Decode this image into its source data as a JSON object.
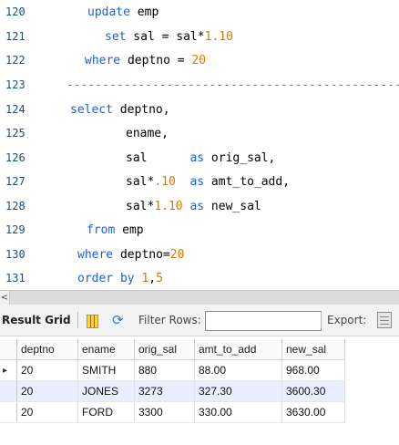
{
  "editor": {
    "lines": [
      {
        "n": "120",
        "parts": [
          {
            "t": "update",
            "c": "kw"
          },
          {
            "t": " emp",
            "c": "plain"
          }
        ]
      },
      {
        "n": "121",
        "parts": [
          {
            "t": "set",
            "c": "kw"
          },
          {
            "t": " sal = sal*",
            "c": "plain"
          },
          {
            "t": "1.10",
            "c": "num"
          }
        ]
      },
      {
        "n": "122",
        "parts": [
          {
            "t": "where",
            "c": "kw"
          },
          {
            "t": " deptno = ",
            "c": "plain"
          },
          {
            "t": "20",
            "c": "num"
          }
        ]
      },
      {
        "n": "123",
        "parts": [
          {
            "t": "------------------------------------------------",
            "c": "dash"
          }
        ]
      },
      {
        "n": "124",
        "parts": [
          {
            "t": "select",
            "c": "kw"
          },
          {
            "t": " deptno,",
            "c": "plain"
          }
        ]
      },
      {
        "n": "125",
        "parts": [
          {
            "t": "ename,",
            "c": "plain"
          }
        ]
      },
      {
        "n": "126",
        "parts": [
          {
            "t": "sal      ",
            "c": "plain"
          },
          {
            "t": "as",
            "c": "kw"
          },
          {
            "t": " orig_sal,",
            "c": "plain"
          }
        ]
      },
      {
        "n": "127",
        "parts": [
          {
            "t": "sal*",
            "c": "plain"
          },
          {
            "t": ".10",
            "c": "num"
          },
          {
            "t": "  ",
            "c": "plain"
          },
          {
            "t": "as",
            "c": "kw"
          },
          {
            "t": " amt_to_add,",
            "c": "plain"
          }
        ]
      },
      {
        "n": "128",
        "parts": [
          {
            "t": "sal*",
            "c": "plain"
          },
          {
            "t": "1.10",
            "c": "num"
          },
          {
            "t": " ",
            "c": "plain"
          },
          {
            "t": "as",
            "c": "kw"
          },
          {
            "t": " new_sal",
            "c": "plain"
          }
        ]
      },
      {
        "n": "129",
        "parts": [
          {
            "t": "from",
            "c": "kw"
          },
          {
            "t": " emp",
            "c": "plain"
          }
        ]
      },
      {
        "n": "130",
        "parts": [
          {
            "t": "where",
            "c": "kw"
          },
          {
            "t": " deptno=",
            "c": "plain"
          },
          {
            "t": "20",
            "c": "num"
          }
        ]
      },
      {
        "n": "131",
        "parts": [
          {
            "t": "order by",
            "c": "kw"
          },
          {
            "t": " ",
            "c": "plain"
          },
          {
            "t": "1",
            "c": "num"
          },
          {
            "t": ",",
            "c": "plain"
          },
          {
            "t": "5",
            "c": "num"
          }
        ]
      }
    ]
  },
  "scroll": {
    "left_arrow": "<"
  },
  "toolbar": {
    "result_grid_label": "Result Grid",
    "filter_rows_label": "Filter Rows:",
    "filter_value": "",
    "export_label": "Export:"
  },
  "grid": {
    "columns": [
      "deptno",
      "ename",
      "orig_sal",
      "amt_to_add",
      "new_sal"
    ],
    "current_row_marker": "▸",
    "rows": [
      [
        "20",
        "SMITH",
        "880",
        "88.00",
        "968.00"
      ],
      [
        "20",
        "JONES",
        "3273",
        "327.30",
        "3600.30"
      ],
      [
        "20",
        "FORD",
        "3300",
        "330.00",
        "3630.00"
      ]
    ]
  }
}
